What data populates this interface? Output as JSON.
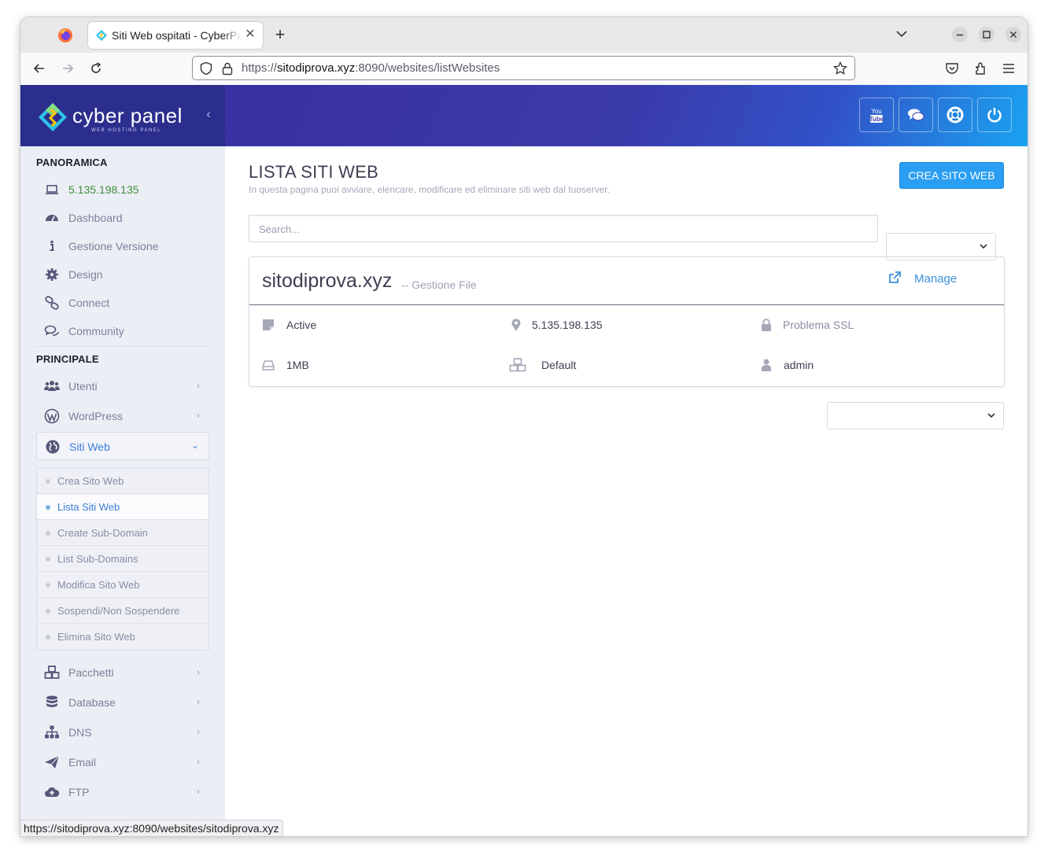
{
  "browser": {
    "tab_title": "Siti Web ospitati - CyberPanel",
    "url_host": "sitodiprova.xyz",
    "url_prefix": "https://",
    "url_rest": ":8090/websites/listWebsites",
    "status_url": "https://sitodiprova.xyz:8090/websites/sitodiprova.xyz"
  },
  "brand": {
    "name": "cyber panel",
    "tagline": "WEB HOSTING PANEL"
  },
  "header_buttons": [
    "youtube-icon",
    "chat-icon",
    "lifebuoy-icon",
    "power-icon"
  ],
  "sidebar": {
    "overview_title": "PANORAMICA",
    "ip": "5.135.198.135",
    "overview_items": [
      {
        "label": "Dashboard",
        "icon": "dashboard-icon"
      },
      {
        "label": "Gestione Versione",
        "icon": "info-icon"
      },
      {
        "label": "Design",
        "icon": "gear-icon"
      },
      {
        "label": "Connect",
        "icon": "link-icon"
      },
      {
        "label": "Community",
        "icon": "comments-icon"
      }
    ],
    "main_title": "PRINCIPALE",
    "main_items": [
      {
        "label": "Utenti",
        "icon": "users-icon"
      },
      {
        "label": "WordPress",
        "icon": "wordpress-icon"
      },
      {
        "label": "Siti Web",
        "icon": "globe-icon"
      }
    ],
    "websites_sub": [
      "Crea Sito Web",
      "Lista Siti Web",
      "Create Sub-Domain",
      "List Sub-Domains",
      "Modifica Sito Web",
      "Sospendi/Non Sospendere",
      "Elimina Sito Web"
    ],
    "more_items": [
      {
        "label": "Pacchetti",
        "icon": "cubes-icon"
      },
      {
        "label": "Database",
        "icon": "database-icon"
      },
      {
        "label": "DNS",
        "icon": "sitemap-icon"
      },
      {
        "label": "Email",
        "icon": "paper-plane-icon"
      },
      {
        "label": "FTP",
        "icon": "cloud-upload-icon"
      }
    ]
  },
  "main": {
    "title": "LISTA SITI WEB",
    "subtitle": "In questa pagina puoi avviare, elencare, modificare ed eliminare siti web dal tuoserver.",
    "create_button": "CREA SITO WEB",
    "search_placeholder": "Search...",
    "site": {
      "domain": "sitodiprova.xyz",
      "file_manager": "-- Gestione File",
      "manage": "Manage",
      "state": "Active",
      "ip": "5.135.198.135",
      "ssl": "Problema SSL",
      "disk": "1MB",
      "package": "Default",
      "owner": "admin"
    }
  },
  "colors": {
    "accent": "#2a9ef2",
    "sidebar_bg": "#eceef5",
    "logo_bg": "#2b2e8c",
    "ip_green": "#3e8f3e"
  }
}
